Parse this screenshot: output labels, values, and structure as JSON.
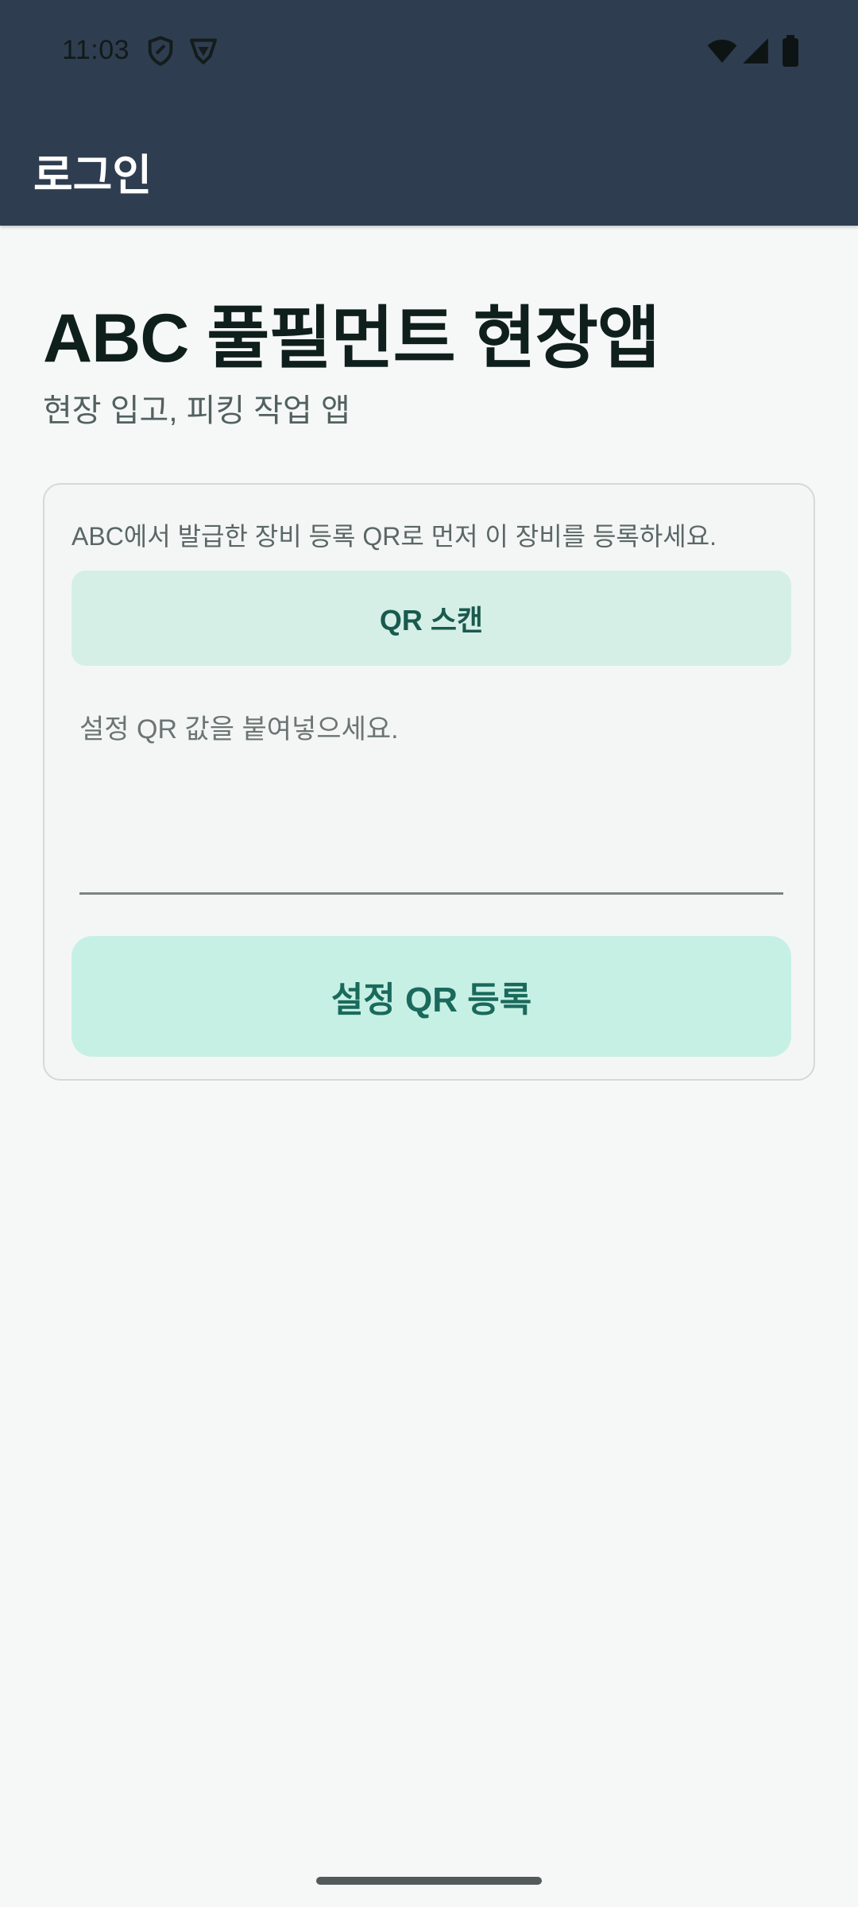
{
  "status_bar": {
    "time": "11:03",
    "icons": [
      "shield-icon",
      "vpn-icon",
      "wifi-icon",
      "signal-icon",
      "battery-icon"
    ]
  },
  "app_bar": {
    "title": "로그인"
  },
  "main": {
    "title": "ABC 풀필먼트 현장앱",
    "subtitle": "현장 입고, 피킹 작업 앱"
  },
  "card": {
    "instructions": "ABC에서 발급한 장비 등록 QR로 먼저 이 장비를 등록하세요.",
    "scan_label": "QR 스캔",
    "input_value": "",
    "input_placeholder": "설정 QR 값을 붙여넣으세요.",
    "register_label": "설정 QR 등록"
  },
  "colors": {
    "app_bar": "#2f3d50",
    "background": "#f6f8f7",
    "scan_button_bg": "#d5efe7",
    "register_button_bg": "#c7f0e5",
    "accent_text": "#1a6a5c"
  }
}
